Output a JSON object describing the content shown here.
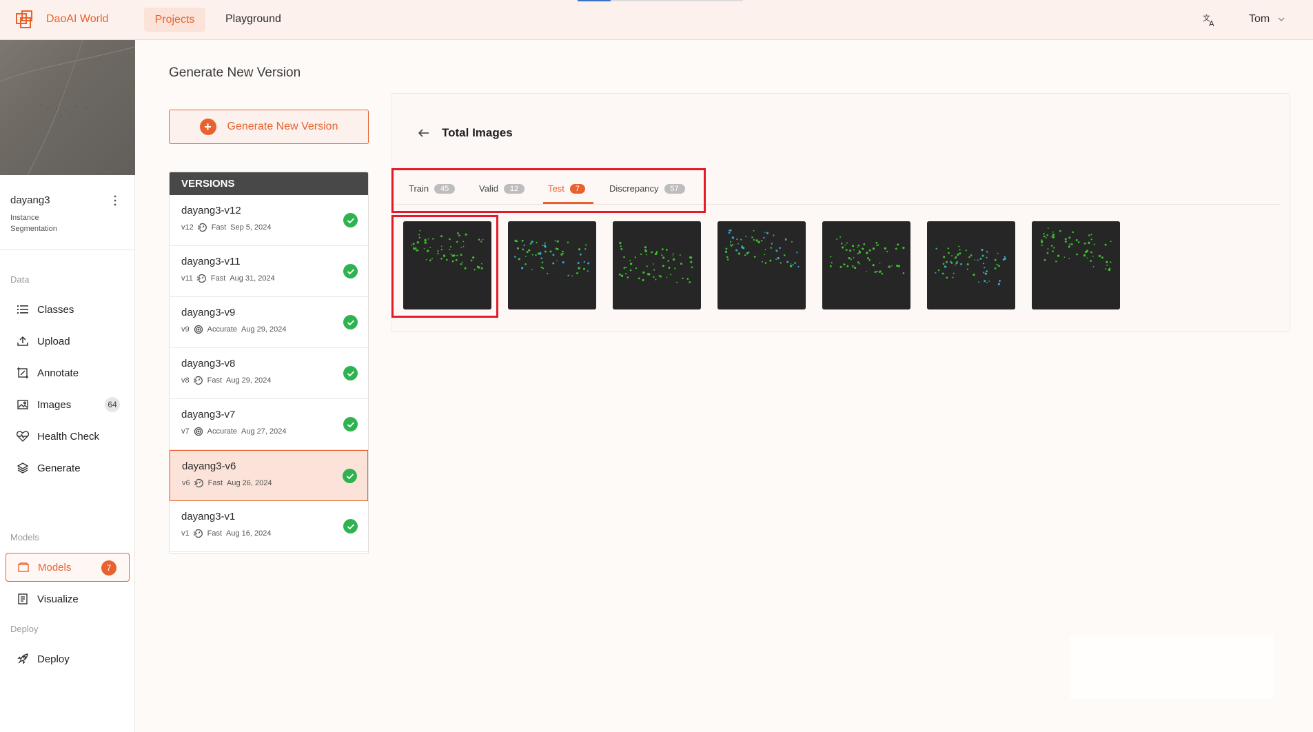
{
  "topbar": {
    "brand": "DaoAI World",
    "nav": [
      "Projects",
      "Playground"
    ],
    "user": "Tom",
    "icons": [
      "logo-icon",
      "translate-icon",
      "chevron-down-icon"
    ]
  },
  "sidebar": {
    "project_name": "dayang3",
    "project_type": "Instance Segmentation",
    "sections": {
      "data": "Data",
      "models": "Models",
      "deploy": "Deploy"
    },
    "items": {
      "classes": "Classes",
      "upload": "Upload",
      "annotate": "Annotate",
      "images": "Images",
      "images_count": "64",
      "health": "Health Check",
      "generate": "Generate",
      "models": "Models",
      "models_count": "7",
      "visualize": "Visualize",
      "deploy": "Deploy"
    }
  },
  "main": {
    "title": "Generate New Version",
    "generate_button": "Generate New Version",
    "versions_header": "VERSIONS",
    "versions": [
      {
        "name": "dayang3-v12",
        "tag": "v12",
        "mode": "Fast",
        "date": "Sep 5, 2024"
      },
      {
        "name": "dayang3-v11",
        "tag": "v11",
        "mode": "Fast",
        "date": "Aug 31, 2024"
      },
      {
        "name": "dayang3-v9",
        "tag": "v9",
        "mode": "Accurate",
        "date": "Aug 29, 2024"
      },
      {
        "name": "dayang3-v8",
        "tag": "v8",
        "mode": "Fast",
        "date": "Aug 29, 2024"
      },
      {
        "name": "dayang3-v7",
        "tag": "v7",
        "mode": "Accurate",
        "date": "Aug 27, 2024"
      },
      {
        "name": "dayang3-v6",
        "tag": "v6",
        "mode": "Fast",
        "date": "Aug 26, 2024"
      },
      {
        "name": "dayang3-v1",
        "tag": "v1",
        "mode": "Fast",
        "date": "Aug 16, 2024"
      }
    ],
    "selected_version": "dayang3-v6",
    "card_title": "Total Images",
    "tabs": [
      {
        "label": "Train",
        "count": "45"
      },
      {
        "label": "Valid",
        "count": "12"
      },
      {
        "label": "Test",
        "count": "7"
      },
      {
        "label": "Discrepancy",
        "count": "57"
      }
    ],
    "active_tab": "Test",
    "accent_color": "#e8622f",
    "success_color": "#2fb351",
    "highlight_color": "#e21b27"
  }
}
